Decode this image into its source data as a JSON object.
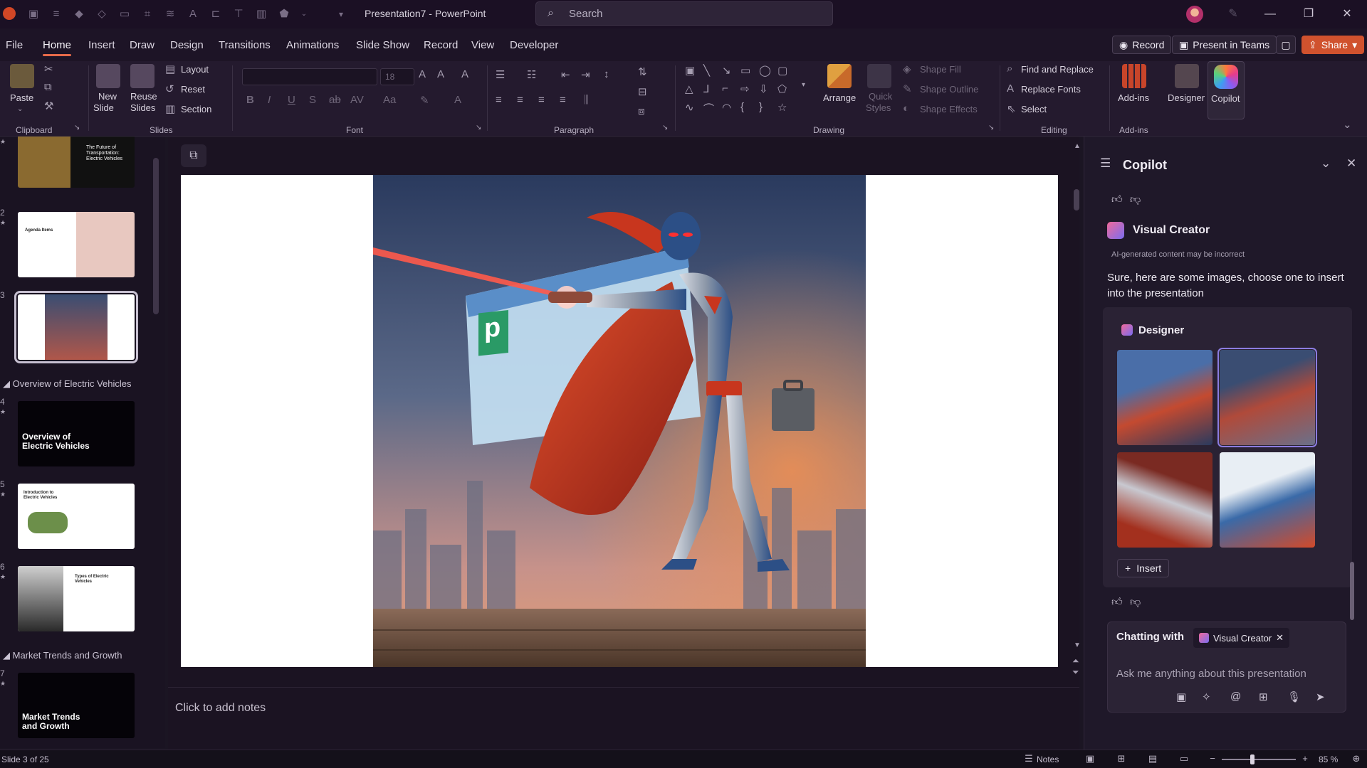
{
  "window": {
    "title": "Presentation7 - PowerPoint"
  },
  "search": {
    "placeholder": "Search"
  },
  "tabs": [
    "File",
    "Home",
    "Insert",
    "Draw",
    "Design",
    "Transitions",
    "Animations",
    "Slide Show",
    "Record",
    "View",
    "Developer"
  ],
  "topbar": {
    "record": "Record",
    "present_in_teams": "Present in Teams",
    "share": "Share"
  },
  "ribbon": {
    "clipboard": {
      "label": "Clipboard",
      "paste": "Paste"
    },
    "slides": {
      "label": "Slides",
      "new_slide": "New",
      "new_slide_2": "Slide",
      "reuse": "Reuse",
      "reuse_2": "Slides",
      "layout": "Layout",
      "reset": "Reset",
      "section": "Section"
    },
    "font": {
      "label": "Font",
      "size": "18"
    },
    "paragraph": {
      "label": "Paragraph"
    },
    "drawing": {
      "label": "Drawing",
      "arrange": "Arrange",
      "quick_styles": "Quick",
      "quick_styles_2": "Styles",
      "shape_fill": "Shape Fill",
      "shape_outline": "Shape Outline",
      "shape_effects": "Shape Effects"
    },
    "editing": {
      "label": "Editing",
      "find_replace": "Find and Replace",
      "replace_fonts": "Replace Fonts",
      "select": "Select"
    },
    "addins": {
      "label": "Add-ins",
      "addins": "Add-ins",
      "designer": "Designer",
      "copilot": "Copilot"
    }
  },
  "thumbnails": {
    "items": [
      {
        "num": "",
        "text": "The Future of Transportation: Electric Vehicles"
      },
      {
        "num": "2",
        "text": "Agenda Items"
      },
      {
        "num": "3",
        "text": ""
      },
      {
        "num": "4",
        "text": "Overview of Electric Vehicles"
      },
      {
        "num": "5",
        "text": "Introduction to Electric Vehicles"
      },
      {
        "num": "6",
        "text": "Types of Electric Vehicles"
      },
      {
        "num": "7",
        "text": "Market Trends and Growth"
      }
    ],
    "sections": [
      "Overview of Electric Vehicles",
      "Market Trends and Growth"
    ]
  },
  "notes": {
    "placeholder": "Click to add notes"
  },
  "copilot": {
    "title": "Copilot",
    "agent": "Visual Creator",
    "disclaimer": "AI-generated content may be incorrect",
    "message": "Sure, here are some images, choose one to insert into the presentation",
    "designer_label": "Designer",
    "insert": "Insert",
    "chatting_with": "Chatting with",
    "chip": "Visual Creator",
    "input_placeholder": "Ask me anything about this presentation"
  },
  "status": {
    "slide_info": "Slide 3 of 25",
    "notes": "Notes",
    "zoom": "85 %"
  },
  "colors": {
    "accent": "#d0522e",
    "hero_suit": "#2c4f86",
    "hero_cape": "#c8361e"
  }
}
